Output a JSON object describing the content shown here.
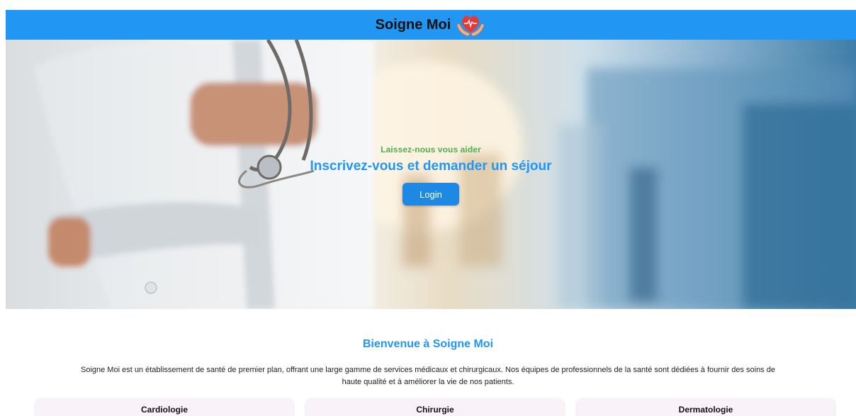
{
  "header": {
    "title": "Soigne Moi",
    "logo_icon": "hands-heart-icon",
    "background_color": "#2196f3"
  },
  "hero": {
    "kicker": "Laissez-nous vous aider",
    "heading": "Inscrivez-vous et demander un séjour",
    "login_label": "Login",
    "kicker_color": "#4caf50",
    "heading_color": "#2196f3"
  },
  "welcome": {
    "title": "Bienvenue à Soigne Moi",
    "lines": [
      "Soigne Moi est un établissement de santé de premier plan, offrant une large gamme de services médicaux et chirurgicaux. Nos équipes de professionnels de la santé sont dédiées à fournir des soins de",
      "haute qualité et à améliorer la vie de nos patients."
    ]
  },
  "services": [
    {
      "title": "Cardiologie"
    },
    {
      "title": "Chirurgie"
    },
    {
      "title": "Dermatologie"
    }
  ]
}
